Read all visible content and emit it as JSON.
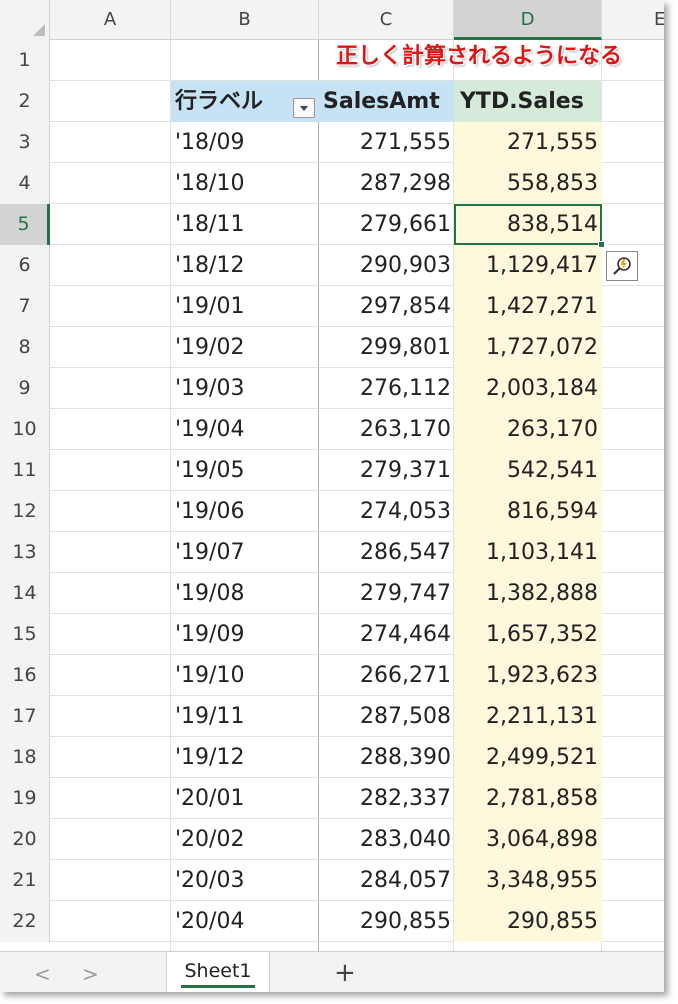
{
  "columns": [
    "A",
    "B",
    "C",
    "D",
    "E"
  ],
  "active_column": "D",
  "active_row": "5",
  "annotation": "正しく計算されるようになる",
  "header_row": {
    "number": "2",
    "b": "行ラベル",
    "c": "SalesAmt",
    "d": "YTD.Sales"
  },
  "first_row_number": "1",
  "rows": [
    {
      "n": "3",
      "b": "'18/09",
      "c": "271,555",
      "d": "271,555"
    },
    {
      "n": "4",
      "b": "'18/10",
      "c": "287,298",
      "d": "558,853"
    },
    {
      "n": "5",
      "b": "'18/11",
      "c": "279,661",
      "d": "838,514"
    },
    {
      "n": "6",
      "b": "'18/12",
      "c": "290,903",
      "d": "1,129,417"
    },
    {
      "n": "7",
      "b": "'19/01",
      "c": "297,854",
      "d": "1,427,271"
    },
    {
      "n": "8",
      "b": "'19/02",
      "c": "299,801",
      "d": "1,727,072"
    },
    {
      "n": "9",
      "b": "'19/03",
      "c": "276,112",
      "d": "2,003,184"
    },
    {
      "n": "10",
      "b": "'19/04",
      "c": "263,170",
      "d": "263,170"
    },
    {
      "n": "11",
      "b": "'19/05",
      "c": "279,371",
      "d": "542,541"
    },
    {
      "n": "12",
      "b": "'19/06",
      "c": "274,053",
      "d": "816,594"
    },
    {
      "n": "13",
      "b": "'19/07",
      "c": "286,547",
      "d": "1,103,141"
    },
    {
      "n": "14",
      "b": "'19/08",
      "c": "279,747",
      "d": "1,382,888"
    },
    {
      "n": "15",
      "b": "'19/09",
      "c": "274,464",
      "d": "1,657,352"
    },
    {
      "n": "16",
      "b": "'19/10",
      "c": "266,271",
      "d": "1,923,623"
    },
    {
      "n": "17",
      "b": "'19/11",
      "c": "287,508",
      "d": "2,211,131"
    },
    {
      "n": "18",
      "b": "'19/12",
      "c": "288,390",
      "d": "2,499,521"
    },
    {
      "n": "19",
      "b": "'20/01",
      "c": "282,337",
      "d": "2,781,858"
    },
    {
      "n": "20",
      "b": "'20/02",
      "c": "283,040",
      "d": "3,064,898"
    },
    {
      "n": "21",
      "b": "'20/03",
      "c": "284,057",
      "d": "3,348,955"
    },
    {
      "n": "22",
      "b": "'20/04",
      "c": "290,855",
      "d": "290,855"
    }
  ],
  "tabs": {
    "prev": "<",
    "next": ">",
    "sheet_name": "Sheet1",
    "add": "+"
  },
  "icons": {
    "quick_analysis": "quick-analysis-icon",
    "filter": "filter-dropdown-icon"
  },
  "colors": {
    "accent": "#217346",
    "pivot_header": "#c5e3f4",
    "ytd_header": "#d6ead9",
    "ytd_fill": "#fef8dc",
    "annotation": "#e01414"
  }
}
